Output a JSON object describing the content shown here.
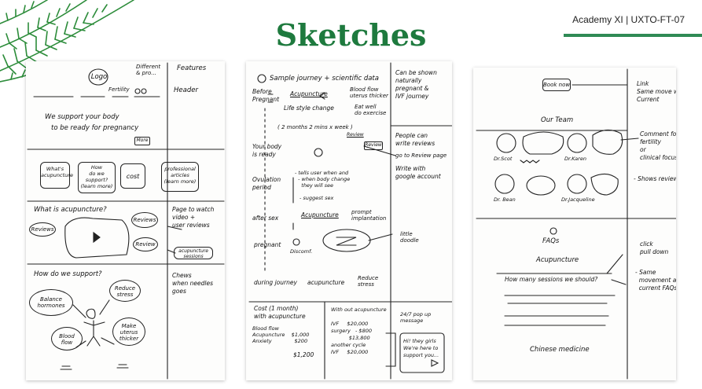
{
  "page": {
    "title": "Sketches",
    "course_label": "Academy XI | UXTO-FT-07",
    "accent_color": "#1e7a3e",
    "decoration_icon": "fern-leaf-icon"
  },
  "sketch1": {
    "logo": "Logo",
    "top_links": "Different\n& pro...",
    "nav": "Fertility",
    "col_features": "Features",
    "col_header": "Header",
    "hero_line1": "We support your body",
    "hero_line2": "to be ready for pregnancy",
    "hero_button": "More",
    "cards": [
      "What's\nacupuncture",
      "How\ndo we\nsupport?\n(learn more)",
      "cost",
      "professional\narticles\n(learn more)"
    ],
    "section2_title": "What is acupuncture?",
    "bubble_reviews_left": "Reviews",
    "bubble_reviews_right": "Reviews",
    "bubble_reviews_right2": "Review",
    "side_video": "Page to watch\nvideo +\nuser reviews",
    "side_button": "acupuncture\nsessions",
    "section3_title": "How do we support?",
    "circle_balance": "Balance\nhormones",
    "circle_reduce": "Reduce\nstress",
    "circle_blood": "Blood\nflow",
    "circle_thicker": "Make\nuterus\nthicker",
    "side_chews": "Chews\nwhen needles\ngoes"
  },
  "sketch2": {
    "header": "Sample journey + scientific data",
    "side_top": "Can be shown\nnaturally\npregnant &\nIVF journey",
    "before": "Before\nPregnant",
    "acupuncture1": "Acupuncture",
    "blood_flow": "Blood flow\nuterus thicker",
    "lifestyle": "Life style change",
    "eat_well": "Eat well\ndo exercise",
    "months": "( 2 months  2 mins x week )",
    "review_small": "Review",
    "review_btn": "Review",
    "ready": "Your body\nis ready",
    "people": "People can\nwrite reviews",
    "go_to": "go to Review page",
    "write_google": "Write with\ngoogle account",
    "ovulation": "Ovulation\nperiod",
    "tells": "- tells user when and\n  - when body change\n    they will see",
    "suggest": "- suggest sex",
    "after_sex": "after sex",
    "acupuncture2": "Acupuncture",
    "prompt": "prompt\nimplantation",
    "pregnant": "pregnant",
    "discomfort": "Discomf.",
    "little_doodle": "little\ndoodle",
    "during": "during journey",
    "acupuncture3": "acupuncture",
    "reduce_stress": "Reduce\nstress",
    "cost_title": "Cost (1 month)\nwith acupuncture",
    "cost_rows": "Blood flow\nAcupuncture    $1,000\nAnxiety              $200",
    "cost_total": "$1,200",
    "without_title": "With out acupuncture",
    "without_rows": "IVF     $20,000\nsurgery   - $800\n           $13,800\nanother cycle\nIVF     $20,000",
    "chat_label": "24/7 pop up\nmessage",
    "chat_text": "Hi! they girls\nWe're here to\nsupport you..."
  },
  "sketch3": {
    "book_now": "Book now",
    "note_link": "Link\nSame move with\nCurrent",
    "our_team": "Our Team",
    "doctors": [
      "Dr.Scot",
      "Dr.Karen",
      "Dr. Bean",
      "Dr.Jacqueline"
    ],
    "note_comment": "Comment for\nfertility\nor\nclinical focus",
    "note_reviews": "- Shows review?",
    "faqs": "FAQs",
    "acupuncture": "Acupuncture",
    "question": "How many sessions we should?",
    "note_pulldown": "click\npull down",
    "note_same": "- Same\n  movement as\n  current FAQs",
    "chinese_medicine": "Chinese medicine"
  }
}
